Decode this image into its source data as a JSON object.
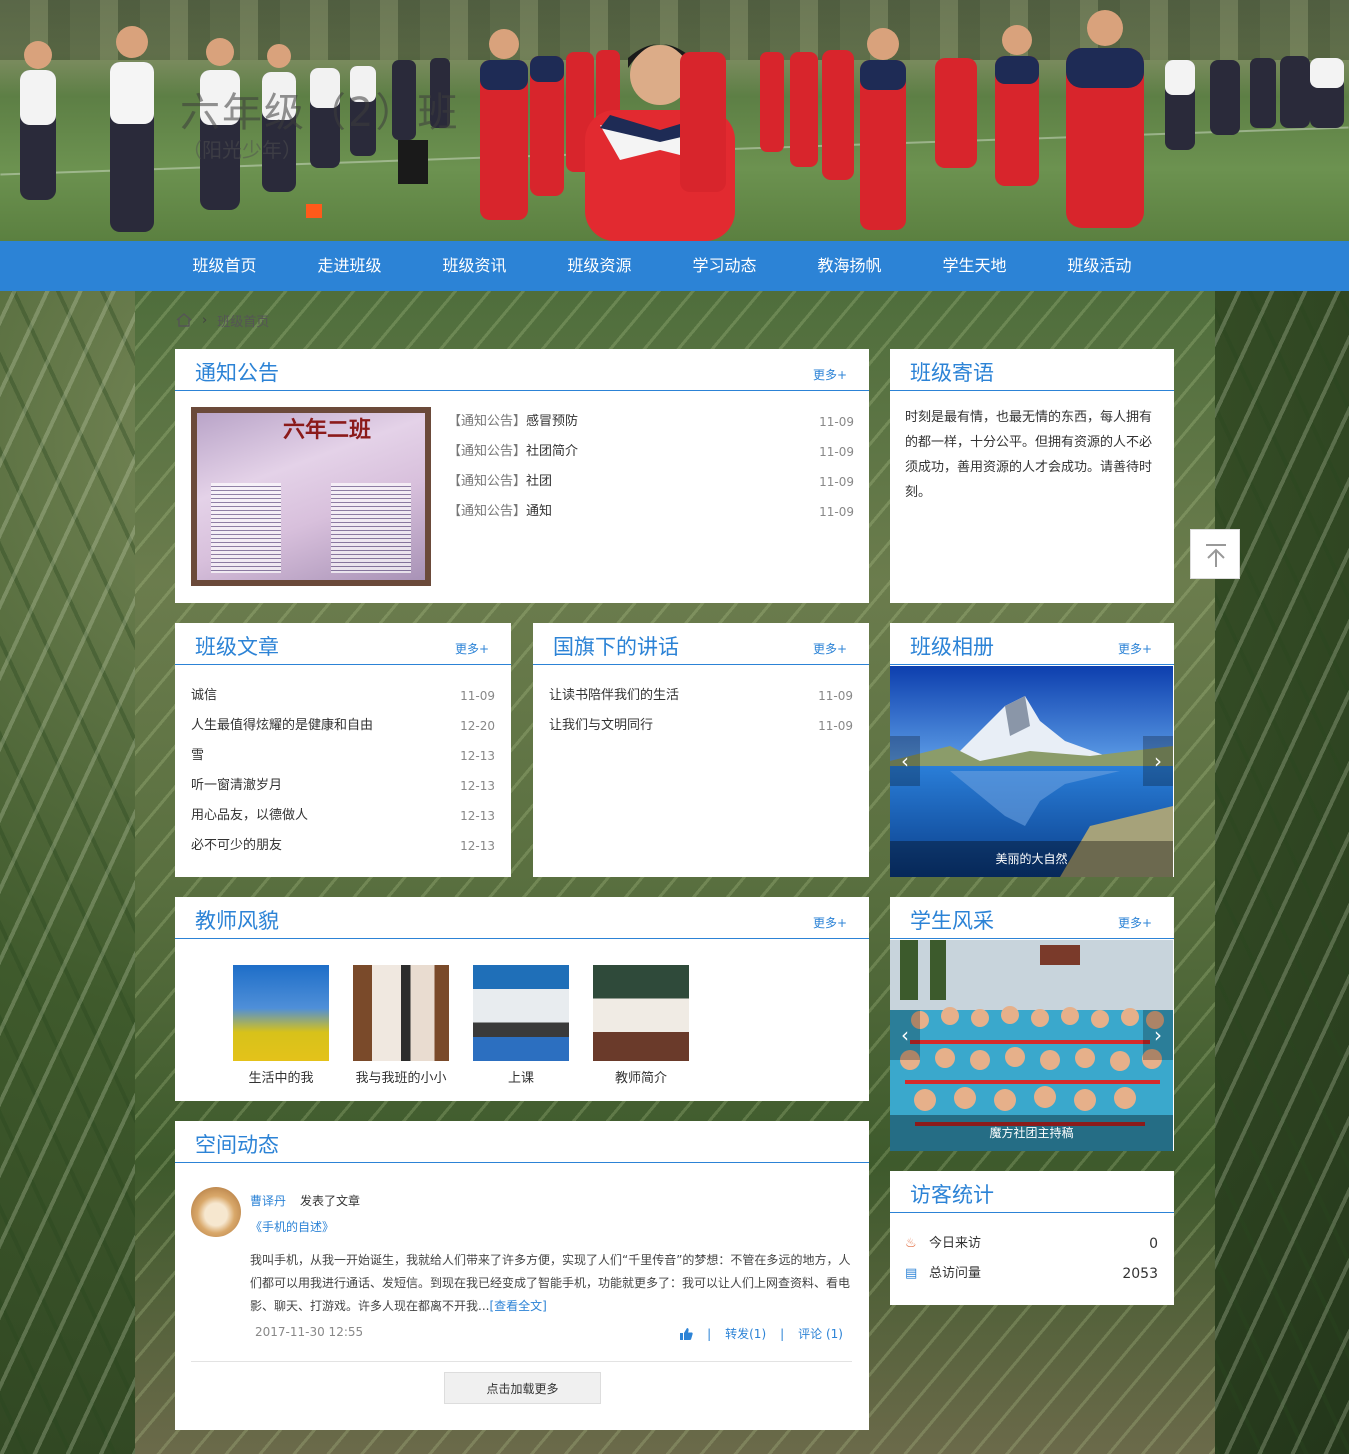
{
  "banner": {
    "title": "六年级（2）班",
    "subtitle": "（阳光少年）"
  },
  "nav": {
    "items": [
      "班级首页",
      "走进班级",
      "班级资讯",
      "班级资源",
      "学习动态",
      "教海扬帆",
      "学生天地",
      "班级活动"
    ]
  },
  "breadcrumb": {
    "current": "班级首页"
  },
  "notice": {
    "title": "通知公告",
    "more": "更多+",
    "image_text": "六年二班",
    "items": [
      {
        "tag": "【通知公告】",
        "text": "感冒预防",
        "date": "11-09"
      },
      {
        "tag": "【通知公告】",
        "text": "社团简介",
        "date": "11-09"
      },
      {
        "tag": "【通知公告】",
        "text": "社团",
        "date": "11-09"
      },
      {
        "tag": "【通知公告】",
        "text": "通知",
        "date": "11-09"
      }
    ]
  },
  "motto": {
    "title": "班级寄语",
    "text": "时刻是最有情，也最无情的东西，每人拥有的都一样，十分公平。但拥有资源的人不必须成功，善用资源的人才会成功。请善待时刻。"
  },
  "articles": {
    "title": "班级文章",
    "more": "更多+",
    "items": [
      {
        "text": "诚信",
        "date": "11-09"
      },
      {
        "text": "人生最值得炫耀的是健康和自由",
        "date": "12-20"
      },
      {
        "text": "雪",
        "date": "12-13"
      },
      {
        "text": "听一窗清澈岁月",
        "date": "12-13"
      },
      {
        "text": "用心品友，以德做人",
        "date": "12-13"
      },
      {
        "text": "必不可少的朋友",
        "date": "12-13"
      }
    ]
  },
  "speech": {
    "title": "国旗下的讲话",
    "more": "更多+",
    "items": [
      {
        "text": "让读书陪伴我们的生活",
        "date": "11-09"
      },
      {
        "text": "让我们与文明同行",
        "date": "11-09"
      }
    ]
  },
  "album": {
    "title": "班级相册",
    "more": "更多+",
    "caption": "美丽的大自然",
    "prev": "‹",
    "next": "›"
  },
  "teachers": {
    "title": "教师风貌",
    "more": "更多+",
    "items": [
      "生活中的我",
      "我与我班的小小",
      "上课",
      "教师简介"
    ]
  },
  "students": {
    "title": "学生风采",
    "more": "更多+",
    "caption": "魔方社团主持稿",
    "prev": "‹",
    "next": "›"
  },
  "space": {
    "title": "空间动态",
    "user": "曹译丹",
    "action": "发表了文章",
    "article": "《手机的自述》",
    "body": "我叫手机，从我一开始诞生，我就给人们带来了许多方便，实现了人们“千里传音”的梦想：不管在多远的地方，人们都可以用我进行通话、发短信。到现在我已经变成了智能手机，功能就更多了：我可以让人们上网查资料、看电影、聊天、打游戏。许多人现在都离不开我...",
    "read_all": "[查看全文]",
    "time": "2017-11-30 12:55",
    "forward": "转发(1)",
    "comment": "评论 (1)",
    "load_more": "点击加载更多"
  },
  "stats": {
    "title": "访客统计",
    "today_label": "今日来访",
    "today_value": "0",
    "total_label": "总访问量",
    "total_value": "2053"
  },
  "colors": {
    "accent": "#2c83d6",
    "nav_bg": "#2c83d6"
  }
}
